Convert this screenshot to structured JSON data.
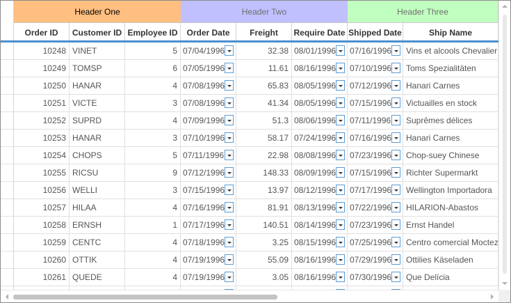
{
  "stacked_headers": [
    {
      "label": "Header One",
      "bg": "#ffbf80",
      "color": "#000000"
    },
    {
      "label": "Header Two",
      "bg": "#c0c0ff",
      "color": "#6f6f6f"
    },
    {
      "label": "Header Three",
      "bg": "#c0ffc0",
      "color": "#6f6f6f"
    }
  ],
  "columns": [
    "Order ID",
    "Customer ID",
    "Employee ID",
    "Order Date",
    "Freight",
    "Require Date",
    "Shipped Date",
    "Ship Name"
  ],
  "rows": [
    {
      "order_id": "10248",
      "customer_id": "VINET",
      "employee_id": "5",
      "order_date": "07/04/1996",
      "freight": "32.38",
      "require_date": "08/01/1996",
      "shipped_date": "07/16/1996",
      "ship_name": "Vins et alcools Chevalier"
    },
    {
      "order_id": "10249",
      "customer_id": "TOMSP",
      "employee_id": "6",
      "order_date": "07/05/1996",
      "freight": "11.61",
      "require_date": "08/16/1996",
      "shipped_date": "07/10/1996",
      "ship_name": "Toms Spezialitäten"
    },
    {
      "order_id": "10250",
      "customer_id": "HANAR",
      "employee_id": "4",
      "order_date": "07/08/1996",
      "freight": "65.83",
      "require_date": "08/05/1996",
      "shipped_date": "07/12/1996",
      "ship_name": "Hanari Carnes"
    },
    {
      "order_id": "10251",
      "customer_id": "VICTE",
      "employee_id": "3",
      "order_date": "07/08/1996",
      "freight": "41.34",
      "require_date": "08/05/1996",
      "shipped_date": "07/15/1996",
      "ship_name": "Victuailles en stock"
    },
    {
      "order_id": "10252",
      "customer_id": "SUPRD",
      "employee_id": "4",
      "order_date": "07/09/1996",
      "freight": "51.3",
      "require_date": "08/06/1996",
      "shipped_date": "07/11/1996",
      "ship_name": "Suprêmes délices"
    },
    {
      "order_id": "10253",
      "customer_id": "HANAR",
      "employee_id": "3",
      "order_date": "07/10/1996",
      "freight": "58.17",
      "require_date": "07/24/1996",
      "shipped_date": "07/16/1996",
      "ship_name": "Hanari Carnes"
    },
    {
      "order_id": "10254",
      "customer_id": "CHOPS",
      "employee_id": "5",
      "order_date": "07/11/1996",
      "freight": "22.98",
      "require_date": "08/08/1996",
      "shipped_date": "07/23/1996",
      "ship_name": "Chop-suey Chinese"
    },
    {
      "order_id": "10255",
      "customer_id": "RICSU",
      "employee_id": "9",
      "order_date": "07/12/1996",
      "freight": "148.33",
      "require_date": "08/09/1996",
      "shipped_date": "07/15/1996",
      "ship_name": "Richter Supermarkt"
    },
    {
      "order_id": "10256",
      "customer_id": "WELLI",
      "employee_id": "3",
      "order_date": "07/15/1996",
      "freight": "13.97",
      "require_date": "08/12/1996",
      "shipped_date": "07/17/1996",
      "ship_name": "Wellington Importadora"
    },
    {
      "order_id": "10257",
      "customer_id": "HILAA",
      "employee_id": "4",
      "order_date": "07/16/1996",
      "freight": "81.91",
      "require_date": "08/13/1996",
      "shipped_date": "07/22/1996",
      "ship_name": "HILARION-Abastos"
    },
    {
      "order_id": "10258",
      "customer_id": "ERNSH",
      "employee_id": "1",
      "order_date": "07/17/1996",
      "freight": "140.51",
      "require_date": "08/14/1996",
      "shipped_date": "07/23/1996",
      "ship_name": "Ernst Handel"
    },
    {
      "order_id": "10259",
      "customer_id": "CENTC",
      "employee_id": "4",
      "order_date": "07/18/1996",
      "freight": "3.25",
      "require_date": "08/15/1996",
      "shipped_date": "07/25/1996",
      "ship_name": "Centro comercial Moctezuma"
    },
    {
      "order_id": "10260",
      "customer_id": "OTTIK",
      "employee_id": "4",
      "order_date": "07/19/1996",
      "freight": "55.09",
      "require_date": "08/16/1996",
      "shipped_date": "07/29/1996",
      "ship_name": "Ottilies Käseladen"
    },
    {
      "order_id": "10261",
      "customer_id": "QUEDE",
      "employee_id": "4",
      "order_date": "07/19/1996",
      "freight": "3.05",
      "require_date": "08/16/1996",
      "shipped_date": "07/30/1996",
      "ship_name": "Que Delícia"
    }
  ]
}
